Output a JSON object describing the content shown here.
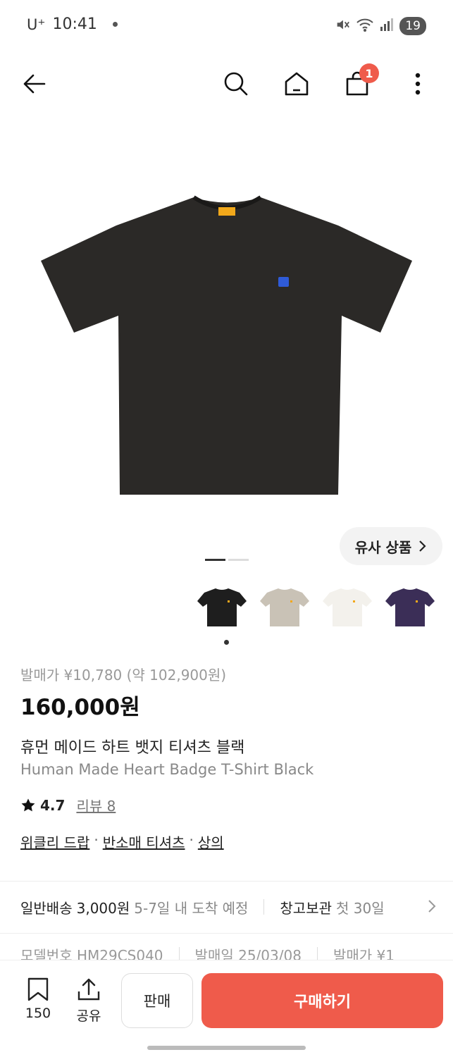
{
  "status_bar": {
    "carrier": "U⁺",
    "time": "10:41",
    "battery": "19"
  },
  "top_nav": {
    "cart_count": "1"
  },
  "image": {
    "similar_label": "유사 상품"
  },
  "thumbnails": [
    {
      "name": "black",
      "color": "#1e1e1e"
    },
    {
      "name": "gray",
      "color": "#c9c2b6"
    },
    {
      "name": "white",
      "color": "#f3f1ec"
    },
    {
      "name": "navy",
      "color": "#3b2e57"
    }
  ],
  "product": {
    "release_price": "발매가 ¥10,780 (약 102,900원)",
    "price": "160,000원",
    "name_ko": "휴먼 메이드 하트 뱃지 티셔츠 블랙",
    "name_en": "Human Made Heart Badge T-Shirt Black",
    "rating": "4.7",
    "review": "리뷰 8",
    "categories": [
      "위클리 드랍",
      "반소매 티셔츠",
      "상의"
    ]
  },
  "shipping": {
    "type": "일반배송",
    "fee": "3,000원",
    "eta": "5-7일 내 도착 예정",
    "storage": "창고보관",
    "storage_note": "첫 30일"
  },
  "meta": {
    "model": "모델번호 HM29CS040",
    "release_date": "발매일 25/03/08",
    "release_price": "발매가 ¥1"
  },
  "bottom_bar": {
    "bookmark_count": "150",
    "share_label": "공유",
    "sell_label": "판매",
    "buy_label": "구매하기"
  },
  "colors": {
    "accent": "#ef5b4b"
  }
}
